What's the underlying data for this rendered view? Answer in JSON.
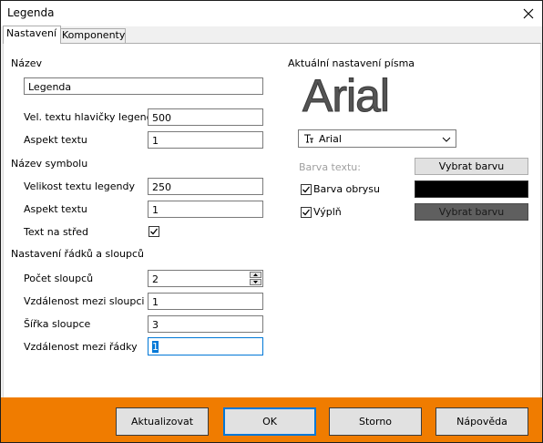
{
  "window": {
    "title": "Legenda"
  },
  "tabs": [
    {
      "label": "Nastavení",
      "active": true
    },
    {
      "label": "Komponenty",
      "active": false
    }
  ],
  "name_section": {
    "heading": "Název",
    "name_value": "Legenda"
  },
  "header_text": {
    "size_label": "Vel. textu hlavičky legendy",
    "size_value": "500",
    "aspect_label": "Aspekt textu",
    "aspect_value": "1"
  },
  "symbol_section": {
    "heading": "Název symbolu",
    "size_label": "Velikost textu legendy",
    "size_value": "250",
    "aspect_label": "Aspekt textu",
    "aspect_value": "1",
    "center_label": "Text na střed",
    "center_checked": true
  },
  "rows_cols_section": {
    "heading": "Nastavení řádků a sloupců",
    "cols_label": "Počet sloupců",
    "cols_value": "2",
    "col_gap_label": "Vzdálenost mezi sloupci",
    "col_gap_value": "1",
    "col_width_label": "Šířka sloupce",
    "col_width_value": "3",
    "row_gap_label": "Vzdálenost mezi řádky",
    "row_gap_value": "1"
  },
  "font_section": {
    "heading": "Aktuální nastavení písma",
    "preview_text": "Arial",
    "font_value": "Arial",
    "text_color_label": "Barva textu:",
    "text_color_button": "Vybrat barvu",
    "outline_label": "Barva obrysu",
    "outline_checked": true,
    "outline_color": "#000000",
    "fill_label": "Výplň",
    "fill_checked": true,
    "fill_button": "Vybrat barvu",
    "fill_color": "#5f5f5f"
  },
  "footer": {
    "update_label": "Aktualizovat",
    "ok_label": "OK",
    "cancel_label": "Storno",
    "help_label": "Nápověda",
    "background_color": "#f07c00"
  }
}
